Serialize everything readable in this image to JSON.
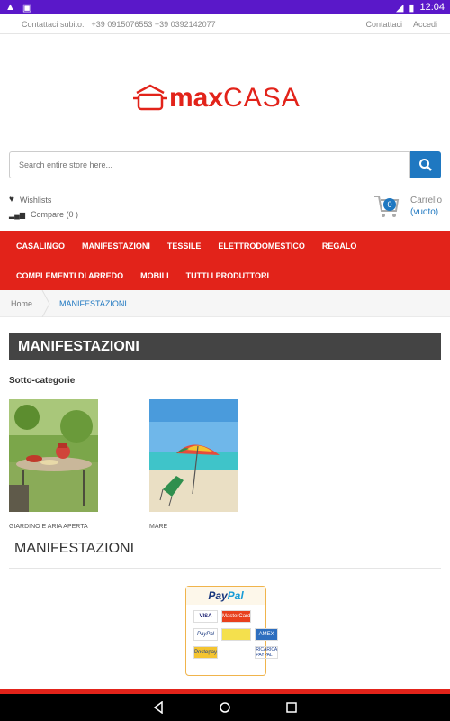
{
  "status_bar": {
    "time": "12:04"
  },
  "topbar": {
    "contact_label": "Contattaci subito:",
    "phones": "+39 0915076553 +39 0392142077",
    "contact_link": "Contattaci",
    "login_link": "Accedi"
  },
  "logo": {
    "max": "max",
    "casa": "CASA"
  },
  "search": {
    "placeholder": "Search entire store here..."
  },
  "header_links": {
    "wishlists": "Wishlists",
    "compare": "Compare (0 )"
  },
  "cart": {
    "count": "0",
    "label": "Carrello",
    "status": "(vuoto)"
  },
  "nav": {
    "row1": [
      "CASALINGO",
      "MANIFESTAZIONI",
      "TESSILE",
      "ELETTRODOMESTICO",
      "REGALO"
    ],
    "row2": [
      "COMPLEMENTI DI ARREDO",
      "MOBILI",
      "TUTTI I PRODUTTORI"
    ]
  },
  "breadcrumb": {
    "home": "Home",
    "current": "MANIFESTAZIONI"
  },
  "page_title": "MANIFESTAZIONI",
  "subcategories": {
    "label": "Sotto-categorie",
    "items": [
      {
        "name": "GIARDINO E ARIA APERTA"
      },
      {
        "name": "MARE"
      }
    ]
  },
  "section_title": "MANIFESTAZIONI",
  "paypal": {
    "pay": "Pay",
    "pal": "Pal",
    "cards": [
      "VISA",
      "MasterCard",
      "PayPal",
      "",
      "",
      "AMEX",
      "Postepay",
      "RICARICA PAYPAL"
    ]
  },
  "colors": {
    "accent_red": "#e2231a",
    "link_blue": "#1f78c1",
    "title_bar": "#444444"
  }
}
